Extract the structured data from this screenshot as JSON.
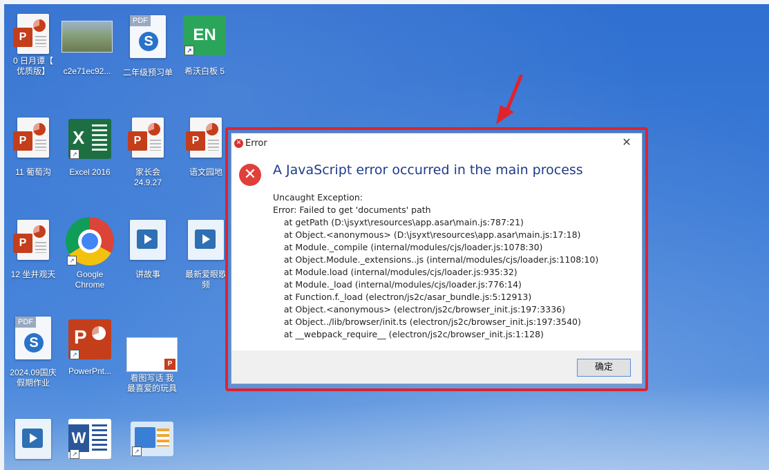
{
  "desktop": {
    "icons": [
      {
        "label": "0 日月谭【\n优质版】",
        "kind": "ppt"
      },
      {
        "label": "c2e71ec92...",
        "kind": "photo"
      },
      {
        "label": "二年级预习单",
        "kind": "pdf"
      },
      {
        "label": "希沃白板 5",
        "kind": "en"
      },
      {
        "label": "11 葡萄沟",
        "kind": "ppt"
      },
      {
        "label": "Excel 2016",
        "kind": "excel"
      },
      {
        "label": "家长会\n24.9.27",
        "kind": "ppt"
      },
      {
        "label": "语文园地",
        "kind": "ppt"
      },
      {
        "label": "12 坐井观天",
        "kind": "ppt"
      },
      {
        "label": "Google\nChrome",
        "kind": "chrome"
      },
      {
        "label": "讲故事",
        "kind": "video"
      },
      {
        "label": "最新爱眼歌\n频",
        "kind": "video"
      },
      {
        "label": "2024.09国庆\n假期作业",
        "kind": "pdf"
      },
      {
        "label": "PowerPnt...",
        "kind": "powerpoint"
      },
      {
        "label": "看图写话 我\n最喜爱的玩具",
        "kind": "slide"
      },
      {
        "label": "",
        "kind": "video"
      },
      {
        "label": "",
        "kind": "word"
      },
      {
        "label": "",
        "kind": "chart"
      }
    ],
    "pdf_tag": "PDF",
    "en_text": "EN"
  },
  "dialog": {
    "title": "Error",
    "heading": "A JavaScript error occurred in the main process",
    "message_lines": [
      "Uncaught Exception:",
      "Error: Failed to get 'documents' path",
      "    at getPath (D:\\jsyxt\\resources\\app.asar\\main.js:787:21)",
      "    at Object.<anonymous> (D:\\jsyxt\\resources\\app.asar\\main.js:17:18)",
      "    at Module._compile (internal/modules/cjs/loader.js:1078:30)",
      "    at Object.Module._extensions..js (internal/modules/cjs/loader.js:1108:10)",
      "    at Module.load (internal/modules/cjs/loader.js:935:32)",
      "    at Module._load (internal/modules/cjs/loader.js:776:14)",
      "    at Function.f._load (electron/js2c/asar_bundle.js:5:12913)",
      "    at Object.<anonymous> (electron/js2c/browser_init.js:197:3336)",
      "    at Object../lib/browser/init.ts (electron/js2c/browser_init.js:197:3540)",
      "    at __webpack_require__ (electron/js2c/browser_init.js:1:128)"
    ],
    "ok_label": "确定",
    "close_glyph": "✕",
    "error_glyph": "✕"
  },
  "colors": {
    "highlight": "#e0222c",
    "heading": "#1e3a8a",
    "desktop": "#3a7ad6"
  }
}
